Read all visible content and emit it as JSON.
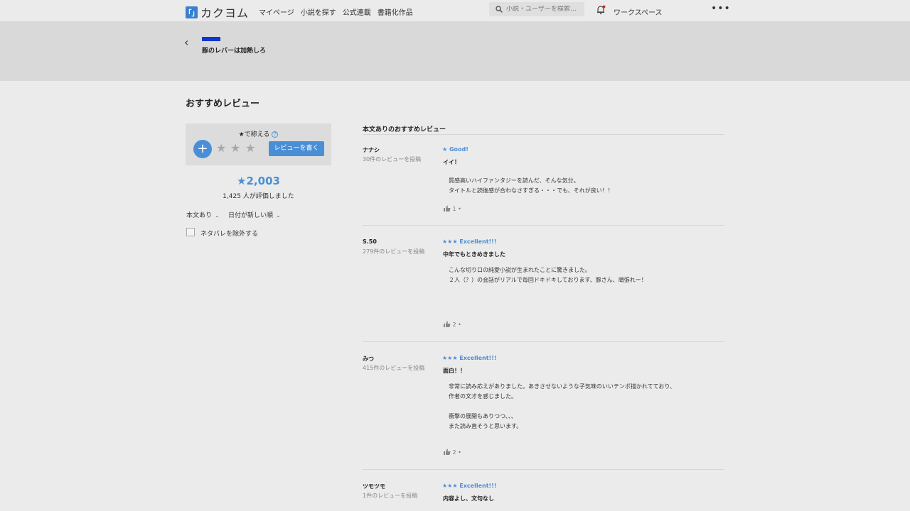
{
  "header": {
    "logo_text": "カクヨム",
    "nav": [
      "マイページ",
      "小説を探す",
      "公式連載",
      "書籍化作品"
    ],
    "search_placeholder": "小説・ユーザーを検索…",
    "workspace_label": "ワークスペース",
    "more_label": "•••"
  },
  "work": {
    "title": "豚のレバーは加熱しろ"
  },
  "page_title": "おすすめレビュー",
  "rating_panel": {
    "label": "★で称える",
    "write_button": "レビューを書く",
    "total_stars": "★2,003",
    "raters": "1,425 人が評価しました",
    "filter_body": "本文あり",
    "filter_sort": "日付が新しい順",
    "spoiler_label": "ネタバレを除外する"
  },
  "review_list": {
    "heading": "本文ありのおすすめレビュー",
    "reviews": [
      {
        "name": "ナナシ",
        "count": "30件のレビューを投稿",
        "rating": "★ Good!",
        "headline": "イイ！",
        "body": "質感高いハイファンタジーを読んだ、そんな気分。\nタイトルと読後感が合わなさすぎる・・・でも、それが良い！！",
        "likes": "1"
      },
      {
        "name": "S.50",
        "count": "279件のレビューを投稿",
        "rating": "★★★ Excellent!!!",
        "headline": "中年でもときめきました",
        "body": "こんな切り口の純愛小説が生まれたことに驚きました。\n２人（？）の会話がリアルで毎回ドキドキしております、豚さん、頑張れー！",
        "likes": "2"
      },
      {
        "name": "みつ",
        "count": "415件のレビューを投稿",
        "rating": "★★★ Excellent!!!",
        "headline": "面白！！",
        "body": "非常に読み応えがありました。あきさせないような子気味のいいテンポ描かれてており、\n作者の文才を感じました。\n\n衝撃の展開もありつつ、、、\nまた読み直そうと思います。",
        "likes": "2"
      },
      {
        "name": "ツモツモ",
        "count": "1件のレビューを投稿",
        "rating": "★★★ Excellent!!!",
        "headline": "内容よし、文句なし",
        "body": "",
        "likes": ""
      }
    ]
  }
}
